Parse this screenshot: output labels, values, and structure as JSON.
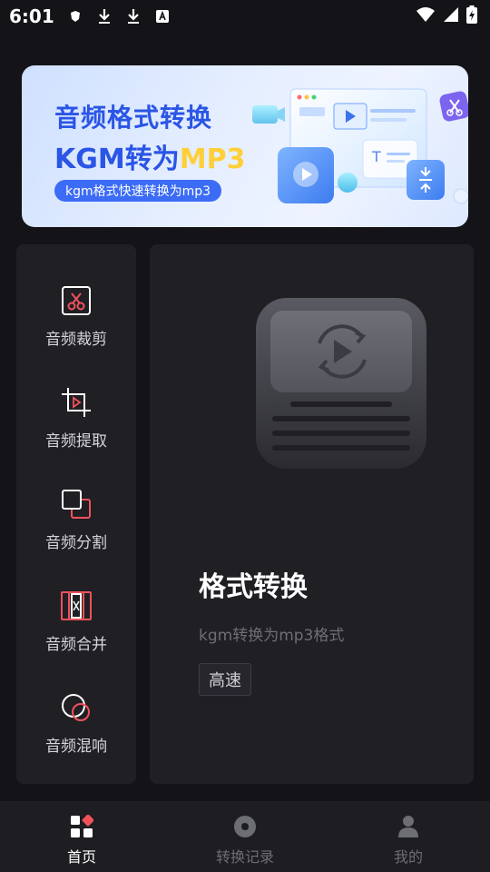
{
  "status_bar": {
    "time": "6:01",
    "notification_icons": [
      "shield-icon",
      "download-icon",
      "download-icon",
      "font-icon"
    ],
    "system_icons": [
      "wifi-icon",
      "signal-icon",
      "battery-charging-icon"
    ]
  },
  "banner": {
    "title_line1": "音频格式转换",
    "title_line2_prefix": "KGM转为",
    "title_line2_highlight": "MP3",
    "pill_text": "kgm格式快速转换为mp3",
    "colors": {
      "title": "#2a55e6",
      "highlight": "#ffcf3a",
      "pill": "#3c6cf5"
    }
  },
  "tools": [
    {
      "label": "音频裁剪",
      "icon": "scissors-icon"
    },
    {
      "label": "音频提取",
      "icon": "crop-icon"
    },
    {
      "label": "音频分割",
      "icon": "split-icon"
    },
    {
      "label": "音频合并",
      "icon": "merge-icon"
    },
    {
      "label": "音频混响",
      "icon": "reverb-icon"
    }
  ],
  "feature_card": {
    "title": "格式转换",
    "description": "kgm转换为mp3格式",
    "tag": "高速",
    "icon": "video-convert-icon"
  },
  "bottom_nav": [
    {
      "label": "首页",
      "icon": "home-grid-icon",
      "active": true
    },
    {
      "label": "转换记录",
      "icon": "record-icon",
      "active": false
    },
    {
      "label": "我的",
      "icon": "user-icon",
      "active": false
    }
  ],
  "accent_color": "#f0525c"
}
